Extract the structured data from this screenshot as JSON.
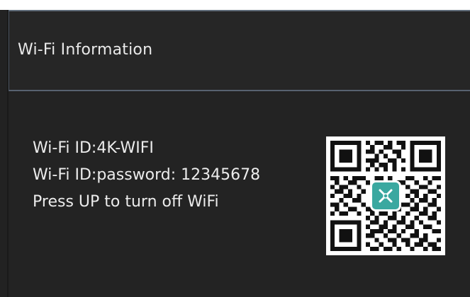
{
  "header": {
    "title": "Wi-Fi Information"
  },
  "wifi_info": {
    "id_line": "Wi-Fi ID:4K-WIFI",
    "password_line": "Wi-Fi ID:password: 12345678",
    "hint_line": "Press UP to turn off WiFi"
  },
  "qr": {
    "icon": "qr-code-icon",
    "logo_icon": "app-logo-icon",
    "logo_color": "#3aa8a0"
  },
  "colors": {
    "background": "#222222",
    "text": "#ececec",
    "divider": "#586270"
  }
}
